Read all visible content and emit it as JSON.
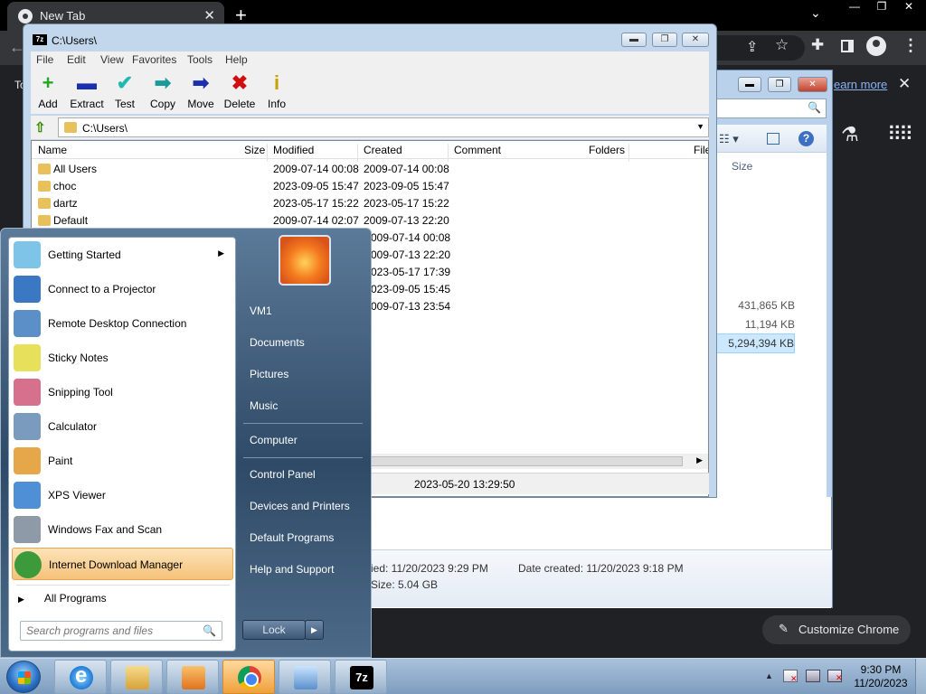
{
  "chrome": {
    "tab_title": "New Tab",
    "tab_close": "✕",
    "new_tab": "+",
    "tab_search": "⌄",
    "win_min": "—",
    "win_restore": "❐",
    "win_close": "✕",
    "back": "←",
    "left_text": "To",
    "learn_more": "earn more",
    "banner_close": "✕",
    "customize": "Customize Chrome",
    "colors": {
      "background": "#202124",
      "tabstrip": "#000000",
      "toolbar": "#35363a",
      "link": "#8ab4f8"
    }
  },
  "explorer": {
    "size_header": "Size",
    "sizes": [
      "431,865 KB",
      "11,194 KB",
      "5,294,394 KB"
    ],
    "details": {
      "modified": "ied: 11/20/2023 9:29 PM",
      "created": "Date created: 11/20/2023 9:18 PM",
      "size": "Size: 5.04 GB"
    }
  },
  "zip": {
    "title": "C:\\Users\\",
    "app_icon": "7z",
    "menu": [
      "File",
      "Edit",
      "View",
      "Favorites",
      "Tools",
      "Help"
    ],
    "tools": [
      {
        "label": "Add",
        "icon": "+",
        "color": "#22a822"
      },
      {
        "label": "Extract",
        "icon": "▬",
        "color": "#1a2fb0"
      },
      {
        "label": "Test",
        "icon": "✔",
        "color": "#20b8b0"
      },
      {
        "label": "Copy",
        "icon": "➡",
        "color": "#1a9a9a"
      },
      {
        "label": "Move",
        "icon": "➡",
        "color": "#1a2fb0"
      },
      {
        "label": "Delete",
        "icon": "✖",
        "color": "#d01010"
      },
      {
        "label": "Info",
        "icon": "i",
        "color": "#c8a000"
      }
    ],
    "address": "C:\\Users\\",
    "columns": [
      "Name",
      "Size",
      "Modified",
      "Created",
      "Comment",
      "Folders",
      "File"
    ],
    "rows": [
      {
        "name": "All Users",
        "modified": "2009-07-14 00:08",
        "created": "2009-07-14 00:08"
      },
      {
        "name": "choc",
        "modified": "2023-09-05 15:47",
        "created": "2023-09-05 15:47"
      },
      {
        "name": "dartz",
        "modified": "2023-05-17 15:22",
        "created": "2023-05-17 15:22"
      },
      {
        "name": "Default",
        "modified": "2009-07-14 02:07",
        "created": "2009-07-13 22:20"
      },
      {
        "name": "",
        "modified": "",
        "created": "009-07-14 00:08"
      },
      {
        "name": "",
        "modified": "",
        "created": "009-07-13 22:20"
      },
      {
        "name": "",
        "modified": "",
        "created": "023-05-17 17:39"
      },
      {
        "name": "",
        "modified": "",
        "created": "023-09-05 15:45"
      },
      {
        "name": "",
        "modified": "",
        "created": "009-07-13 23:54"
      }
    ],
    "status_date": "2023-05-20 13:29:50"
  },
  "start_menu": {
    "programs": [
      {
        "label": "Getting Started",
        "icon": "getting-started-icon",
        "submenu": true,
        "color": "#7ec3e8"
      },
      {
        "label": "Connect to a Projector",
        "icon": "projector-icon",
        "submenu": false,
        "color": "#3b78c4"
      },
      {
        "label": "Remote Desktop Connection",
        "icon": "remote-desktop-icon",
        "submenu": false,
        "color": "#5a8fc8"
      },
      {
        "label": "Sticky Notes",
        "icon": "sticky-notes-icon",
        "submenu": false,
        "color": "#e7e05a"
      },
      {
        "label": "Snipping Tool",
        "icon": "scissors-icon",
        "submenu": false,
        "color": "#d7708c"
      },
      {
        "label": "Calculator",
        "icon": "calculator-icon",
        "submenu": false,
        "color": "#7a9bbd"
      },
      {
        "label": "Paint",
        "icon": "paint-icon",
        "submenu": false,
        "color": "#e6a64a"
      },
      {
        "label": "XPS Viewer",
        "icon": "xps-viewer-icon",
        "submenu": false,
        "color": "#4f8fd6"
      },
      {
        "label": "Windows Fax and Scan",
        "icon": "fax-icon",
        "submenu": false,
        "color": "#8f9aa8"
      },
      {
        "label": "Internet Download Manager",
        "icon": "idm-icon",
        "submenu": false,
        "color": "#3d9a3a"
      }
    ],
    "all_programs": "All Programs",
    "search_placeholder": "Search programs and files",
    "right_items": [
      "VM1",
      "Documents",
      "Pictures",
      "Music",
      "Computer",
      "Control Panel",
      "Devices and Printers",
      "Default Programs",
      "Help and Support"
    ],
    "lock": "Lock",
    "lock_arrow": "▶"
  },
  "taskbar": {
    "apps": [
      "internet-explorer",
      "windows-explorer",
      "media-player",
      "google-chrome",
      "control-panel",
      "7-zip"
    ],
    "zip_label": "7z",
    "time": "9:30 PM",
    "date": "11/20/2023",
    "tray_arrow": "▲"
  }
}
